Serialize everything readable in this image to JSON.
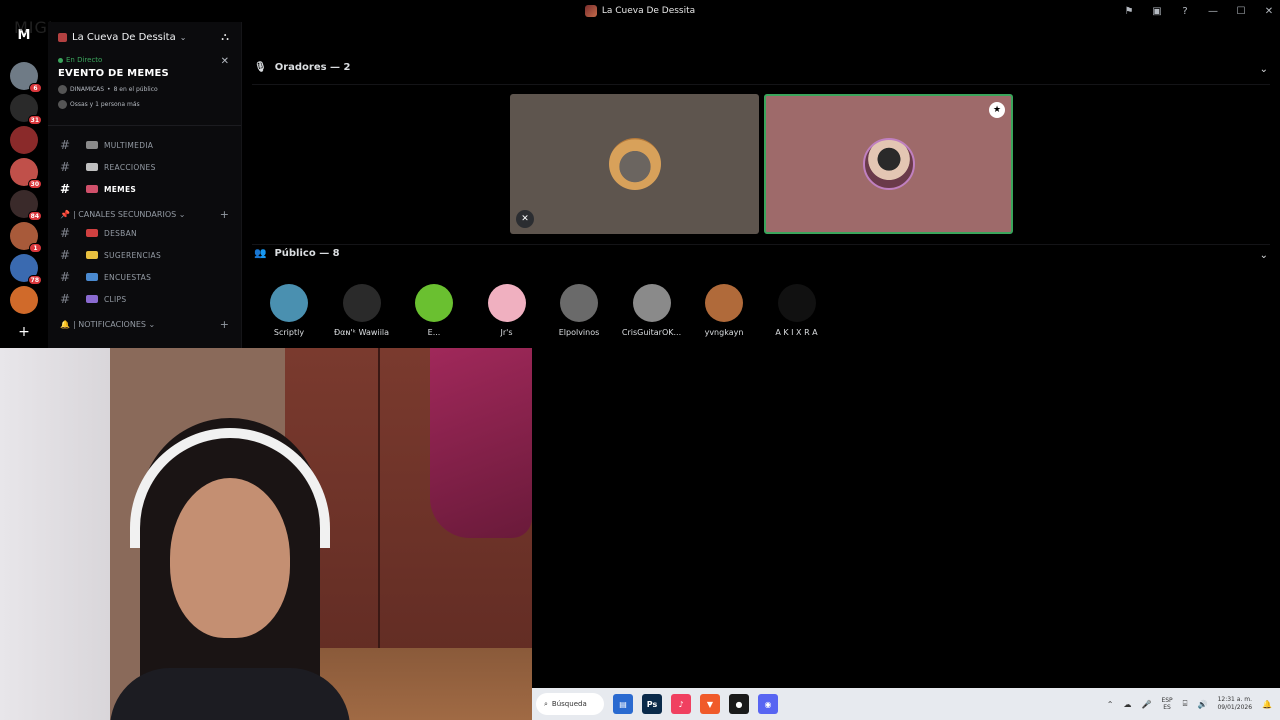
{
  "window": {
    "title": "La Cueva De Dessita",
    "controls": [
      "—",
      "☐",
      "✕"
    ]
  },
  "overlay_text": "MIGI",
  "rail": {
    "home_label": "M",
    "servers": [
      {
        "badge": "6",
        "color": "#6f7b86"
      },
      {
        "badge": "31",
        "color": "#2a2a2a"
      },
      {
        "badge": "",
        "color": "#8a2a2a"
      },
      {
        "badge": "30",
        "color": "#c0504a"
      },
      {
        "badge": "84",
        "color": "#3a2a2a"
      },
      {
        "badge": "1",
        "color": "#a85a3a"
      },
      {
        "badge": "78",
        "color": "#3a6ab0"
      },
      {
        "badge": "",
        "color": "#d06a2a"
      }
    ],
    "add_label": "+"
  },
  "sidebar": {
    "server_name": "La Cueva De Dessita",
    "event": {
      "live_label": "En Directo",
      "title": "EVENTO DE MEMES",
      "meta1": "DINAMICAS",
      "meta1b": "8 en el público",
      "meta2": "Ossas y 1 persona más"
    },
    "channels": [
      {
        "name": "MULTIMEDIA",
        "emo": "#8a8a8a",
        "active": false
      },
      {
        "name": "REACCIONES",
        "emo": "#c0c0c0",
        "active": false
      },
      {
        "name": "MEMES",
        "emo": "#d0506a",
        "active": true
      }
    ],
    "category2": "| CANALES SECUNDARIOS",
    "channels2": [
      {
        "name": "DESBAN",
        "emo": "#d04040"
      },
      {
        "name": "SUGERENCIAS",
        "emo": "#e8c040"
      },
      {
        "name": "ENCUESTAS",
        "emo": "#4a8ad0"
      },
      {
        "name": "CLIPS",
        "emo": "#8a6ad0"
      }
    ],
    "category3": "| NOTIFICACIONES"
  },
  "stage": {
    "speakers_label": "Oradores — 2",
    "audience_label": "Público — 8",
    "audience": [
      {
        "name": "Scriptly",
        "color": "#4a90b0"
      },
      {
        "name": "Ðαɴ'ᵏ Wawiila",
        "color": "#2a2a2a"
      },
      {
        "name": "E...",
        "color": "#6ac030"
      },
      {
        "name": "Jr's",
        "color": "#f0b0c0"
      },
      {
        "name": "Elpolvinos",
        "color": "#6a6a6a"
      },
      {
        "name": "CrisGuitarOK...",
        "color": "#8a8a8a"
      },
      {
        "name": "yvngkayn",
        "color": "#b06a3a"
      },
      {
        "name": "A K I X R A",
        "color": "#111111"
      }
    ]
  },
  "taskbar": {
    "search_placeholder": "Búsqueda",
    "apps": [
      {
        "name": "folder",
        "label": "▤",
        "color": "#2a6ad0"
      },
      {
        "name": "photoshop",
        "label": "Ps",
        "color": "#0a2a4a"
      },
      {
        "name": "music",
        "label": "♪",
        "color": "#f04060"
      },
      {
        "name": "brave",
        "label": "▼",
        "color": "#f05a2a"
      },
      {
        "name": "discord-app",
        "label": "●",
        "color": "#1a1a1a"
      },
      {
        "name": "discord",
        "label": "◉",
        "color": "#5865f2"
      }
    ],
    "lang_top": "ESP",
    "lang_bottom": "ES",
    "time": "12:31 a. m.",
    "date": "09/01/2026"
  }
}
